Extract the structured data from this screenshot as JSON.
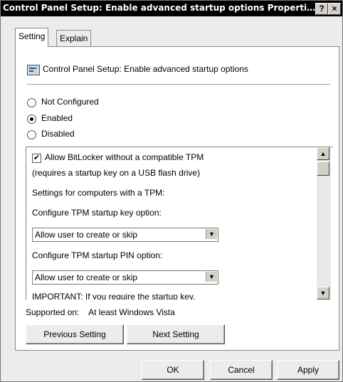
{
  "window": {
    "title": "Control Panel Setup: Enable advanced startup options Properti...",
    "help_label": "?",
    "close_label": "×"
  },
  "tabs": [
    {
      "label": "Setting"
    },
    {
      "label": "Explain"
    }
  ],
  "policy": {
    "name": "Control Panel Setup: Enable advanced startup options"
  },
  "radios": [
    {
      "label": "Not Configured"
    },
    {
      "label": "Enabled"
    },
    {
      "label": "Disabled"
    }
  ],
  "options": {
    "allow_bitlocker_label": "Allow BitLocker without a compatible TPM",
    "allow_bitlocker_checked": true,
    "startup_key_note": "(requires a startup key on a USB flash drive)",
    "tpm_settings_heading": "Settings for computers with a TPM:",
    "tpm_key_label": "Configure TPM startup key option:",
    "tpm_key_value": "Allow user to create or skip",
    "tpm_pin_label": "Configure TPM startup PIN option:",
    "tpm_pin_value": "Allow user to create or skip",
    "important_text": "IMPORTANT: If you require the startup key,"
  },
  "supported": {
    "label": "Supported on:",
    "value": "At least Windows Vista"
  },
  "buttons": {
    "previous": "Previous Setting",
    "next": "Next Setting",
    "ok": "OK",
    "cancel": "Cancel",
    "apply": "Apply"
  }
}
